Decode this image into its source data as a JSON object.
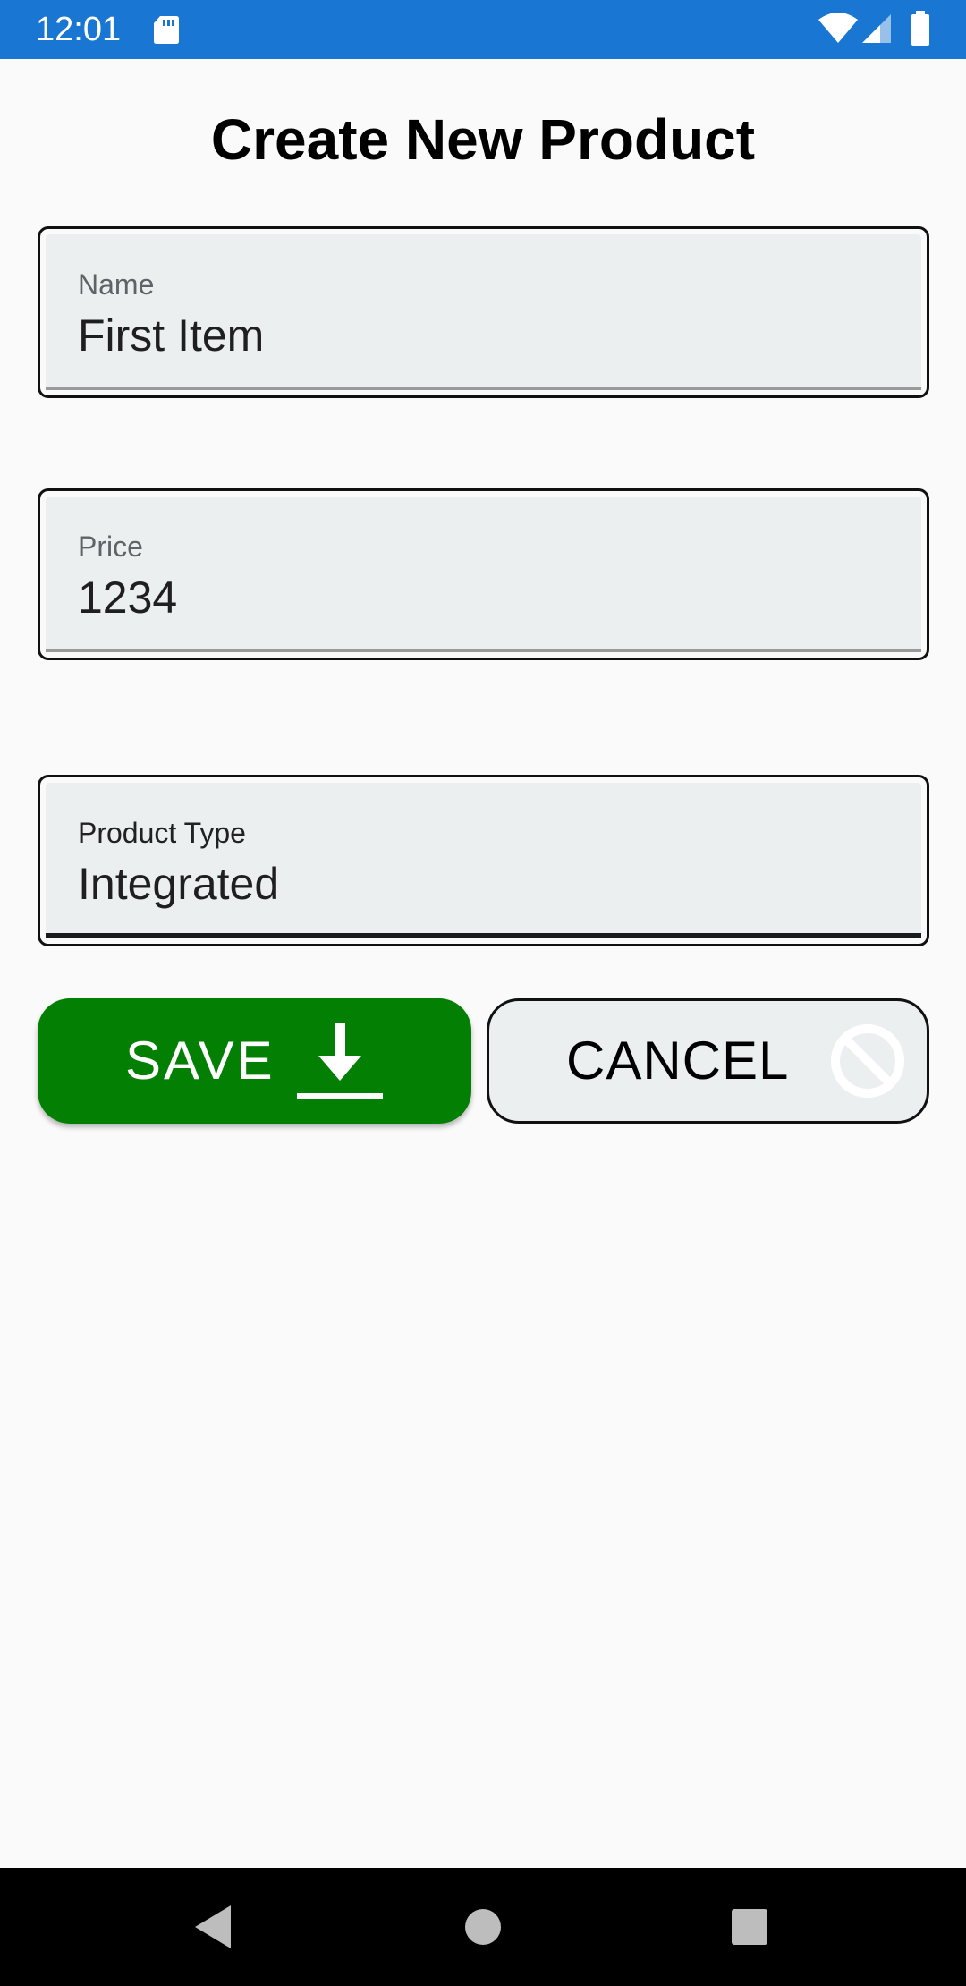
{
  "status_bar": {
    "time": "12:01",
    "background_color": "#1976d2",
    "icons": [
      "sd-card-icon",
      "wifi-icon",
      "signal-icon",
      "battery-icon"
    ]
  },
  "page": {
    "title": "Create New Product"
  },
  "form": {
    "name": {
      "label": "Name",
      "value": "First Item"
    },
    "price": {
      "label": "Price",
      "value": "1234"
    },
    "product_type": {
      "label": "Product Type",
      "value": "Integrated",
      "focused": true
    }
  },
  "actions": {
    "save": {
      "label": "SAVE",
      "icon": "download-icon",
      "color": "#038003"
    },
    "cancel": {
      "label": "CANCEL",
      "icon": "block-icon"
    }
  },
  "nav_bar": {
    "buttons": [
      "back-icon",
      "home-icon",
      "recents-icon"
    ]
  }
}
